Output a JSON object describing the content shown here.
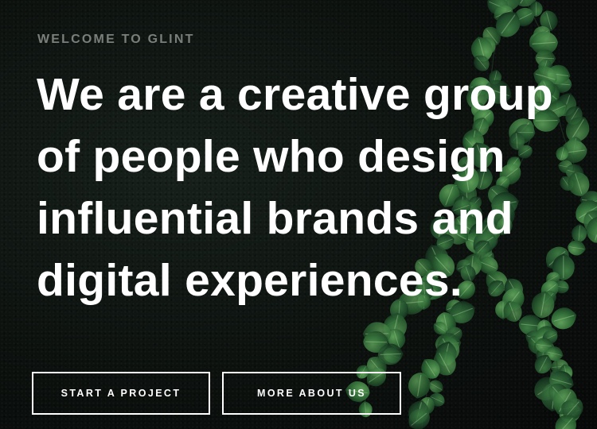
{
  "hero": {
    "eyebrow": "WELCOME TO GLINT",
    "headline_lines": [
      "We are a creative group",
      "of people who design",
      "influential brands and",
      "digital experiences."
    ],
    "buttons": {
      "start_project": "START A PROJECT",
      "more_about_us": "MORE ABOUT US"
    },
    "background_image": "ivy-wall"
  },
  "colors": {
    "background": "#0b0e0c",
    "text": "#ffffff",
    "eyebrow": "#7b7f7c",
    "leaf_dark": "#1f4a2a",
    "leaf_light": "#4f8a4a"
  }
}
